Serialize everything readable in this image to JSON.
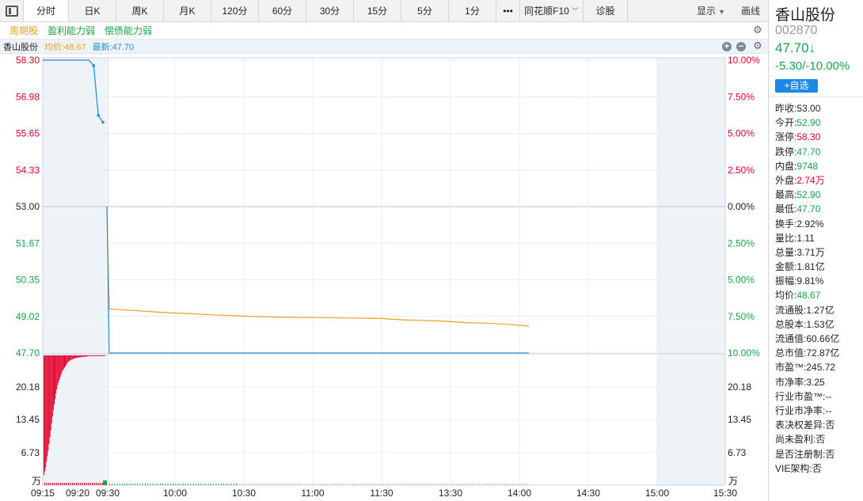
{
  "toolbar": {
    "tabs": [
      {
        "label": "分时",
        "active": true,
        "w": 57
      },
      {
        "label": "日K",
        "w": 60
      },
      {
        "label": "周K",
        "w": 60
      },
      {
        "label": "月K",
        "w": 60
      },
      {
        "label": "120分",
        "w": 60
      },
      {
        "label": "60分",
        "w": 60
      },
      {
        "label": "30分",
        "w": 60
      },
      {
        "label": "15分",
        "w": 60
      },
      {
        "label": "5分",
        "w": 60
      },
      {
        "label": "1分",
        "w": 60
      },
      {
        "label": "•••",
        "w": 30
      },
      {
        "label": "同花顺F10",
        "w": 80,
        "chevron": true
      },
      {
        "label": "诊股",
        "w": 56
      }
    ],
    "display_label": "显示",
    "draw_label": "画线"
  },
  "tags": [
    {
      "text": "周期股",
      "color": "#f0a020"
    },
    {
      "text": "盈利能力弱",
      "color": "#1aa34a"
    },
    {
      "text": "偿债能力弱",
      "color": "#1aa34a"
    }
  ],
  "legend": {
    "name": "香山股份",
    "avg": "均价:48.67",
    "last": "最新:47.70"
  },
  "chart_data": {
    "type": "line",
    "price_axis": {
      "left_labels": [
        "58.30",
        "56.98",
        "55.65",
        "54.33",
        "53.00",
        "51.67",
        "50.35",
        "49.02",
        "47.70"
      ],
      "right_labels": [
        "10.00%",
        "7.50%",
        "5.00%",
        "2.50%",
        "0.00%",
        "2.50%",
        "5.00%",
        "7.50%",
        "10.00%"
      ],
      "ylim": [
        47.7,
        58.3
      ],
      "prev_close": 53.0
    },
    "volume_axis": {
      "labels": [
        "20.18",
        "13.45",
        "6.73"
      ],
      "unit": "万"
    },
    "x_labels": [
      "09:15",
      "09:20",
      "09:30",
      "10:00",
      "10:30",
      "11:00",
      "11:30",
      "13:30",
      "14:00",
      "14:30",
      "15:00",
      "15:30"
    ],
    "call_auction": [
      58.3,
      58.3,
      58.3,
      58.3,
      58.3,
      58.3,
      58.3,
      58.3,
      58.3,
      58.3,
      58.3,
      58.1,
      56.3,
      56.05
    ],
    "series": [
      {
        "role": "price",
        "color": "#2a8fd8",
        "values": [
          53.0,
          47.7,
          47.7,
          47.7,
          47.7,
          47.7,
          47.7,
          47.7,
          47.7,
          47.7,
          47.7,
          47.7,
          47.7,
          47.7,
          47.7,
          47.7,
          47.7,
          47.7,
          47.7,
          47.7,
          47.7
        ]
      },
      {
        "role": "avg",
        "color": "#f0a020",
        "values": [
          53.0,
          49.3,
          49.2,
          49.15,
          49.12,
          49.08,
          49.05,
          49.02,
          49.0,
          48.99,
          48.98,
          48.97,
          48.96,
          48.95,
          48.9,
          48.88,
          48.85,
          48.8,
          48.78,
          48.74,
          48.67
        ]
      }
    ],
    "volume_bars": [
      0.88,
      0.85,
      0.82,
      0.78,
      0.74,
      0.7,
      0.65,
      0.6,
      0.55,
      0.5,
      0.45,
      0.4,
      0.36,
      0.32,
      0.28,
      0.25,
      0.22,
      0.2,
      0.18,
      0.16,
      0.14,
      0.12,
      0.11,
      0.1,
      0.09,
      0.08,
      0.07,
      0.06,
      0.05,
      0.045,
      0.04,
      0.035,
      0.03,
      0.03,
      0.025,
      0.025,
      0.02,
      0.02,
      0.02,
      0.018,
      0.016,
      0.015,
      0.014,
      0.013,
      0.012,
      0.011,
      0.01,
      0.01,
      0.01,
      0.008,
      0.008,
      0.008,
      0.006,
      0.006,
      0.006,
      0.005,
      0.005,
      0.004,
      0.004,
      0.004,
      0.003,
      0.003,
      0.003,
      0.003,
      0.002,
      0.002,
      0.002,
      0.002,
      0.002,
      0.002,
      0.002,
      0.002
    ],
    "colors": {
      "up": "#e4002b",
      "down": "#1aa34a",
      "price": "#2a8fd8",
      "avg": "#f0a020"
    }
  },
  "stock": {
    "name": "香山股份",
    "code": "002870",
    "price": "47.70↓",
    "change": "-5.30/-10.00%",
    "watch_button": "+自选",
    "stats": [
      {
        "k": "昨收:",
        "v": "53.00",
        "c": "dark"
      },
      {
        "k": "今开:",
        "v": "52.90",
        "c": "green"
      },
      {
        "k": "涨停:",
        "v": "58.30",
        "c": "red"
      },
      {
        "k": "跌停:",
        "v": "47.70",
        "c": "green"
      },
      {
        "k": "内盘:",
        "v": "9748",
        "c": "green"
      },
      {
        "k": "外盘:",
        "v": "2.74万",
        "c": "red"
      },
      {
        "k": "最高:",
        "v": "52.90",
        "c": "green"
      },
      {
        "k": "最低:",
        "v": "47.70",
        "c": "green"
      },
      {
        "k": "换手:",
        "v": "2.92%",
        "c": "dark"
      },
      {
        "k": "量比:",
        "v": "1.11",
        "c": "dark"
      },
      {
        "k": "总量:",
        "v": "3.71万",
        "c": "dark"
      },
      {
        "k": "金额:",
        "v": "1.81亿",
        "c": "dark"
      },
      {
        "k": "振幅:",
        "v": "9.81%",
        "c": "dark"
      },
      {
        "k": "均价:",
        "v": "48.67",
        "c": "green"
      },
      {
        "k": "流通股:",
        "v": "1.27亿",
        "c": "dark"
      },
      {
        "k": "总股本:",
        "v": "1.53亿",
        "c": "dark"
      },
      {
        "k": "流通值:",
        "v": "60.66亿",
        "c": "dark"
      },
      {
        "k": "总市值:",
        "v": "72.87亿",
        "c": "dark"
      },
      {
        "k": "市盈™:",
        "v": "245.72",
        "c": "dark"
      },
      {
        "k": "市净率:",
        "v": "3.25",
        "c": "dark"
      },
      {
        "k": "行业市盈™:",
        "v": "--",
        "c": "dark"
      },
      {
        "k": "行业市净率:",
        "v": "--",
        "c": "dark"
      },
      {
        "k": "表决权差异:",
        "v": "否",
        "c": "dark"
      },
      {
        "k": "尚未盈利:",
        "v": "否",
        "c": "dark"
      },
      {
        "k": "是否注册制:",
        "v": "否",
        "c": "dark"
      },
      {
        "k": "VIE架构:",
        "v": "否",
        "c": "dark"
      }
    ]
  }
}
